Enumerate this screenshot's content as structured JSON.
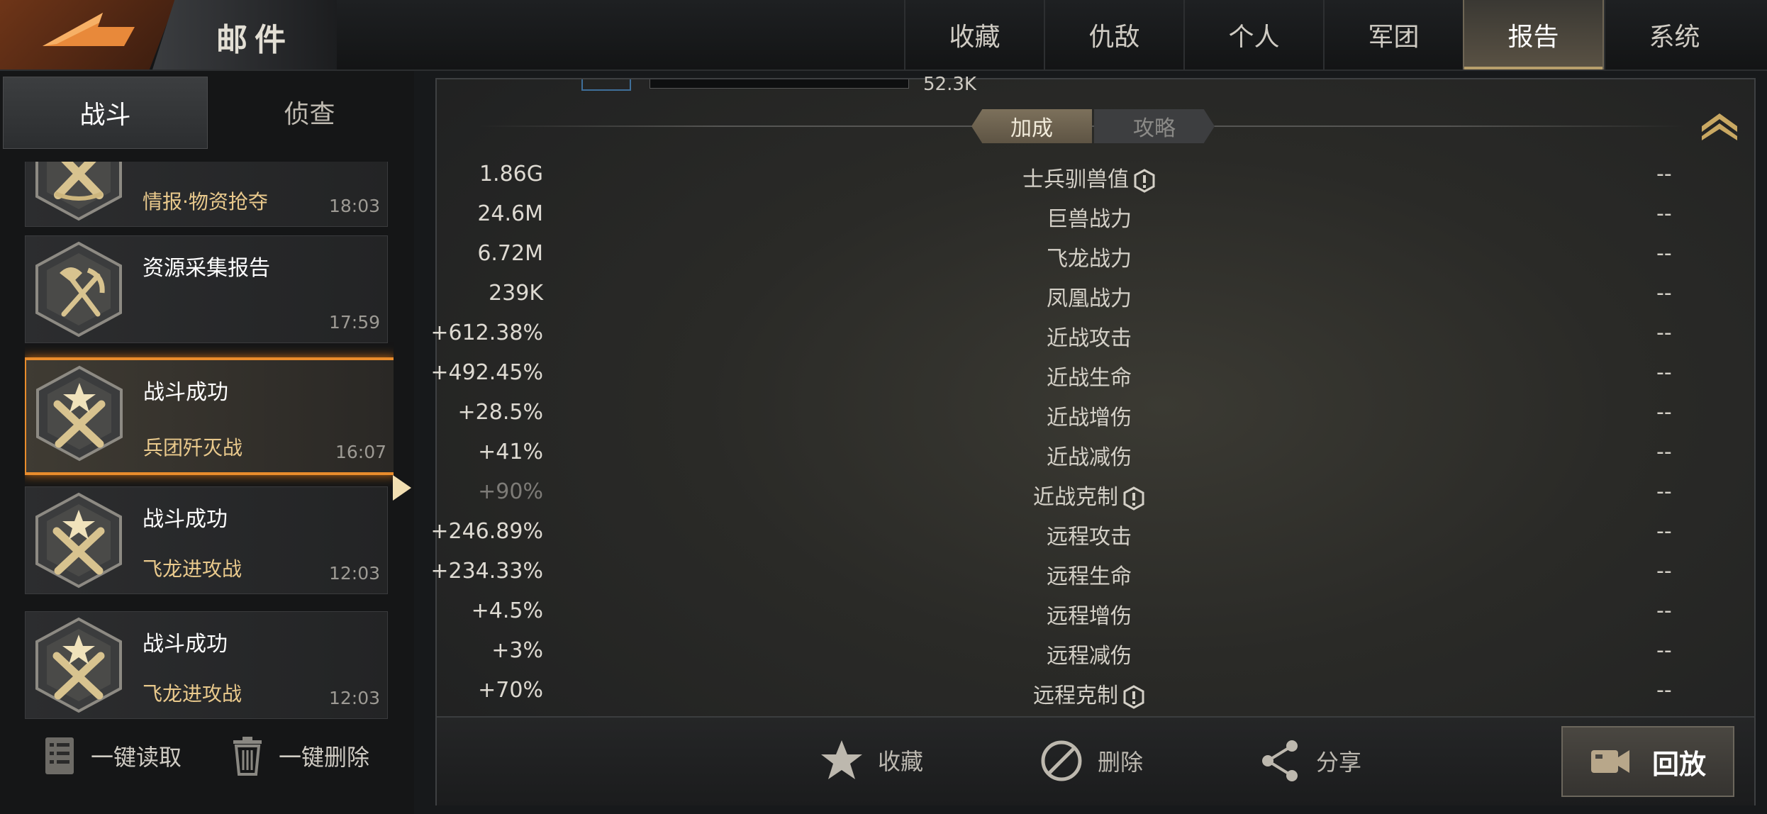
{
  "header": {
    "title": "邮件",
    "tabs": [
      {
        "label": "收藏",
        "active": false
      },
      {
        "label": "仇敌",
        "active": false
      },
      {
        "label": "个人",
        "active": false
      },
      {
        "label": "军团",
        "active": false
      },
      {
        "label": "报告",
        "active": true
      },
      {
        "label": "系统",
        "active": false
      }
    ]
  },
  "sidebar": {
    "subtabs": [
      {
        "label": "战斗",
        "active": true
      },
      {
        "label": "侦查",
        "active": false
      }
    ],
    "items": [
      {
        "title": "",
        "subtitle": "情报·物资抢夺",
        "time": "18:03",
        "icon": "crossed-guns-badge-icon"
      },
      {
        "title": "资源采集报告",
        "subtitle": "",
        "time": "17:59",
        "icon": "shovel-pickaxe-badge-icon"
      },
      {
        "title": "战斗成功",
        "subtitle": "兵团歼灭战",
        "time": "16:07",
        "icon": "star-crossed-guns-badge-icon",
        "selected": true
      },
      {
        "title": "战斗成功",
        "subtitle": "飞龙进攻战",
        "time": "12:03",
        "icon": "star-crossed-guns-badge-icon"
      },
      {
        "title": "战斗成功",
        "subtitle": "飞龙进攻战",
        "time": "12:03",
        "icon": "star-crossed-guns-badge-icon"
      }
    ],
    "bulk_read_label": "一键读取",
    "bulk_delete_label": "一键删除"
  },
  "report": {
    "top_partial_value": "52.3K",
    "segments": {
      "active": "加成",
      "inactive": "攻略"
    },
    "rows": [
      {
        "value": "1.86G",
        "label": "士兵驯兽值",
        "info": true,
        "opponent": "--"
      },
      {
        "value": "24.6M",
        "label": "巨兽战力",
        "info": false,
        "opponent": "--"
      },
      {
        "value": "6.72M",
        "label": "飞龙战力",
        "info": false,
        "opponent": "--"
      },
      {
        "value": "239K",
        "label": "凤凰战力",
        "info": false,
        "opponent": "--"
      },
      {
        "value": "+612.38%",
        "label": "近战攻击",
        "info": false,
        "opponent": "--"
      },
      {
        "value": "+492.45%",
        "label": "近战生命",
        "info": false,
        "opponent": "--"
      },
      {
        "value": "+28.5%",
        "label": "近战增伤",
        "info": false,
        "opponent": "--"
      },
      {
        "value": "+41%",
        "label": "近战减伤",
        "info": false,
        "opponent": "--"
      },
      {
        "value": "+90%",
        "label": "近战克制",
        "info": true,
        "opponent": "--",
        "dim": true
      },
      {
        "value": "+246.89%",
        "label": "远程攻击",
        "info": false,
        "opponent": "--"
      },
      {
        "value": "+234.33%",
        "label": "远程生命",
        "info": false,
        "opponent": "--"
      },
      {
        "value": "+4.5%",
        "label": "远程增伤",
        "info": false,
        "opponent": "--"
      },
      {
        "value": "+3%",
        "label": "远程减伤",
        "info": false,
        "opponent": "--"
      },
      {
        "value": "+70%",
        "label": "远程克制",
        "info": true,
        "opponent": "--"
      }
    ],
    "actions": {
      "favorite_label": "收藏",
      "delete_label": "删除",
      "share_label": "分享",
      "replay_label": "回放"
    }
  },
  "colors": {
    "accent_orange": "#e98c2c",
    "gold": "#b79f6c",
    "subtitle_gold": "#e9c98c"
  }
}
